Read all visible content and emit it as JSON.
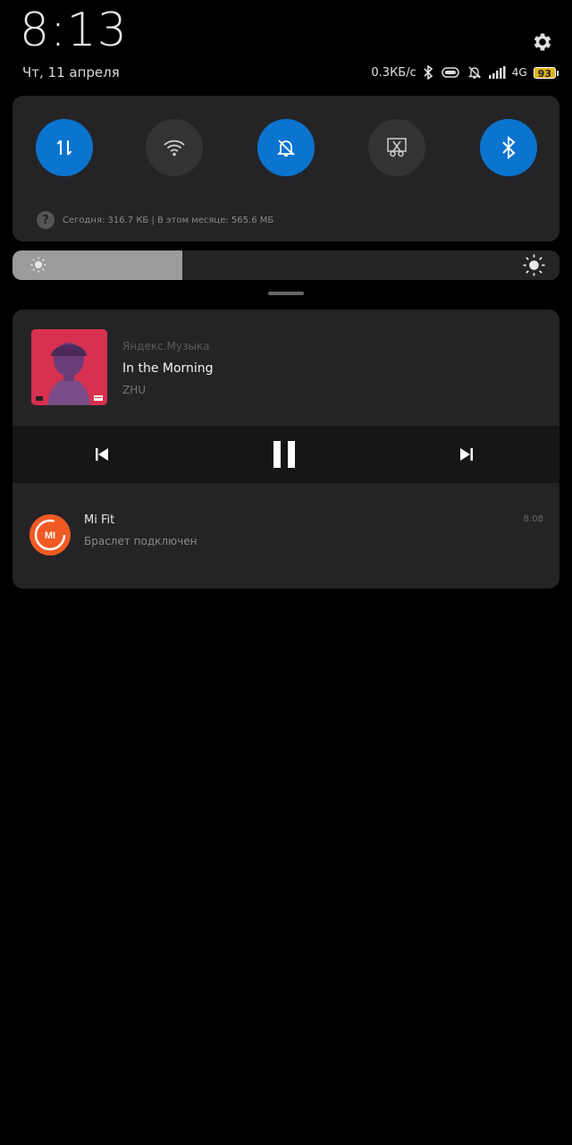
{
  "header": {
    "time": "8:13",
    "date": "Чт, 11 апреля",
    "net_speed": "0.3КБ/с",
    "network": "4G",
    "battery": "93"
  },
  "quick_settings": {
    "toggles": [
      {
        "name": "mobile-data",
        "icon": "data-arrows-icon",
        "on": true
      },
      {
        "name": "wifi",
        "icon": "wifi-icon",
        "on": false
      },
      {
        "name": "silent",
        "icon": "bell-off-icon",
        "on": true
      },
      {
        "name": "screenshot",
        "icon": "scissors-icon",
        "on": false
      },
      {
        "name": "bluetooth",
        "icon": "bluetooth-icon",
        "on": true
      }
    ],
    "usage_text": "Сегодня: 316.7 КБ | В этом месяце: 565.6 МБ"
  },
  "brightness": {
    "level": 0.31
  },
  "music": {
    "app": "Яндекс.Музыка",
    "title": "In the Morning",
    "artist": "ZHU"
  },
  "notification": {
    "app": "Mi Fit",
    "text": "Браслет подключен",
    "time": "8:08"
  },
  "colors": {
    "accent": "#0a74cf",
    "panel": "#242426",
    "mi_orange": "#f15a22"
  }
}
